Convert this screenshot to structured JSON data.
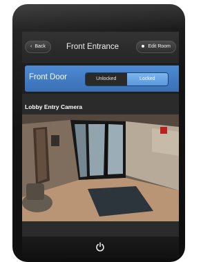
{
  "header": {
    "back_label": "Back",
    "title": "Front Entrance",
    "edit_label": "Edit Room"
  },
  "lock": {
    "door_name": "Front Door",
    "options": [
      "Unlocked",
      "Locked"
    ],
    "selected": "Locked",
    "accent": "#3f7bc4"
  },
  "camera": {
    "title": "Lobby Entry Camera"
  },
  "footer": {
    "power_icon": "power-icon"
  }
}
